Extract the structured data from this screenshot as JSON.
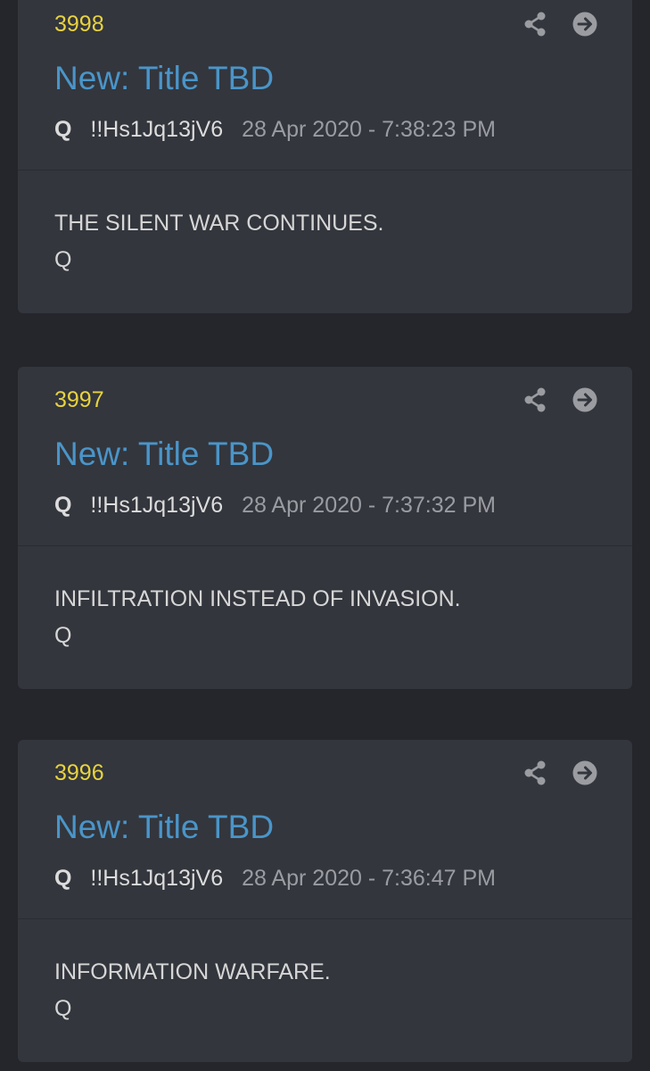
{
  "posts": [
    {
      "number": "3998",
      "title": "New: Title TBD",
      "author": "Q",
      "tripcode": "!!Hs1Jq13jV6",
      "timestamp": "28 Apr 2020 - 7:38:23 PM",
      "message": "THE SILENT WAR CONTINUES.",
      "signature": "Q"
    },
    {
      "number": "3997",
      "title": "New: Title TBD",
      "author": "Q",
      "tripcode": "!!Hs1Jq13jV6",
      "timestamp": "28 Apr 2020 - 7:37:32 PM",
      "message": "INFILTRATION INSTEAD OF INVASION.",
      "signature": "Q"
    },
    {
      "number": "3996",
      "title": "New: Title TBD",
      "author": "Q",
      "tripcode": "!!Hs1Jq13jV6",
      "timestamp": "28 Apr 2020 - 7:36:47 PM",
      "message": "INFORMATION WARFARE.",
      "signature": "Q"
    }
  ],
  "icons": {
    "share": "share-icon",
    "open": "arrow-circle-right-icon"
  },
  "colors": {
    "background": "#24262c",
    "card": "#33363d",
    "post_number": "#e8d33f",
    "title": "#4a95c9",
    "icon": "#9a9ca1"
  }
}
